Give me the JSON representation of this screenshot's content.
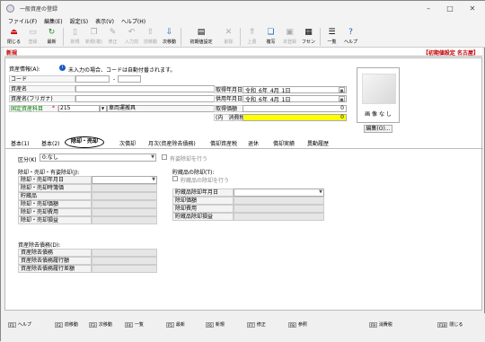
{
  "window": {
    "title": "一般資産の登録"
  },
  "menu": [
    "ファイル(F)",
    "編集(E)",
    "設定(S)",
    "表示(V)",
    "ヘルプ(H)"
  ],
  "toolbar": [
    {
      "label": "閉じる",
      "icon": "close-icon",
      "enabled": true
    },
    {
      "label": "登録",
      "icon": "save-icon",
      "enabled": false
    },
    {
      "label": "最新",
      "icon": "refresh-icon",
      "enabled": true
    },
    {
      "label": "新規",
      "icon": "new-icon",
      "enabled": false
    },
    {
      "label": "新規(複)",
      "icon": "copy-new-icon",
      "enabled": false
    },
    {
      "label": "修正",
      "icon": "edit-icon",
      "enabled": false
    },
    {
      "label": "入力前",
      "icon": "undo-icon",
      "enabled": false
    },
    {
      "label": "前移動",
      "icon": "arrow-up-icon",
      "enabled": false
    },
    {
      "label": "次移動",
      "icon": "arrow-down-icon",
      "enabled": true
    },
    {
      "label": "初期値設定",
      "icon": "settings-icon",
      "enabled": true
    },
    {
      "label": "削除",
      "icon": "delete-icon",
      "enabled": false
    },
    {
      "label": "上書",
      "icon": "overwrite-icon",
      "enabled": false
    },
    {
      "label": "複写",
      "icon": "copy-icon",
      "enabled": true
    },
    {
      "label": "本登録",
      "icon": "register-icon",
      "enabled": false
    },
    {
      "label": "フセン",
      "icon": "sticky-note-icon",
      "enabled": true
    },
    {
      "label": "一覧",
      "icon": "list-icon",
      "enabled": true
    },
    {
      "label": "ヘルプ",
      "icon": "help-icon",
      "enabled": true
    }
  ],
  "mode": {
    "label": "新規",
    "right": "【初期値設定 名古屋】"
  },
  "asset_info": {
    "header": "資産情報(A):",
    "note": "未入力の場合、コードは自動付番されます。",
    "code_label": "コード",
    "code_value": "",
    "code_dash": "-",
    "name_label": "資産名",
    "name_value": "",
    "kana_label": "資産名(フリガナ)",
    "kana_value": "",
    "account_label": "固定資産科目",
    "account_value": "215",
    "account_name": "車両運搬具"
  },
  "dates": {
    "acquired_label": "取得年月日",
    "acquired_era": "令和",
    "acquired_year": "6年",
    "acquired_month": "4月",
    "acquired_day": "1日",
    "service_label": "供用年月日",
    "service_era": "令和",
    "service_year": "6年",
    "service_month": "4月",
    "service_day": "1日",
    "cost_label": "取得価額",
    "cost_value": "0",
    "tax_label": "(内　消費税)",
    "tax_value": "0"
  },
  "photo": {
    "text": "画 像 な し",
    "edit_label": "編集(O)..."
  },
  "tabs": [
    "基本(1)",
    "基本(2)",
    "除却・売却",
    "次償却",
    "月次(資産除去債務)",
    "償却資産税",
    "退休",
    "償却実績",
    "異動履歴"
  ],
  "disposal": {
    "kubun_label": "区分(K)",
    "kubun_value": "0:なし",
    "asset_disposal_check": "有姿除却を行う",
    "section1_title": "除却・売却・有姿除却(J):",
    "rows1": [
      "除却・売却年月日",
      "除却・売却時簿価",
      "貯蔵品",
      "除却・売却価額",
      "除却・売却費用",
      "除却・売却損益"
    ],
    "section2_title": "貯蔵品の除却(T):",
    "storage_check": "貯蔵品の除却を行う",
    "rows2": [
      "貯蔵品除却年月日",
      "除却価額",
      "除却費用",
      "貯蔵品除却損益"
    ],
    "section3_title": "資産除去債務(D):",
    "rows3": [
      "資産除去債務",
      "資産除去債務履行額",
      "資産除去債務履行差額"
    ]
  },
  "fkeys": [
    {
      "key": "F1",
      "label": "ヘルプ"
    },
    {
      "key": "F2",
      "label": "前移動"
    },
    {
      "key": "F3",
      "label": "次移動"
    },
    {
      "key": "F4",
      "label": "一覧"
    },
    {
      "key": "F5",
      "label": "最新"
    },
    {
      "key": "F6",
      "label": "新規"
    },
    {
      "key": "F7",
      "label": "修正"
    },
    {
      "key": "F8",
      "label": "参照"
    },
    {
      "key": "F9",
      "label": "消費税"
    },
    {
      "key": "F10",
      "label": "閉じる"
    }
  ]
}
